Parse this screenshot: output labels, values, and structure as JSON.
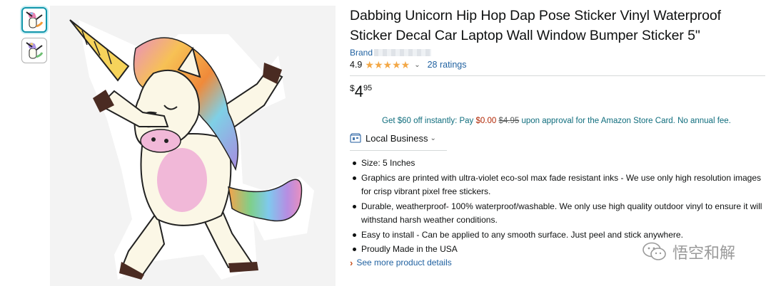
{
  "product": {
    "title": "Dabbing Unicorn Hip Hop Dap Pose Sticker Vinyl Waterproof Sticker Decal Car Laptop Wall Window Bumper Sticker 5\"",
    "brand_label": "Brand",
    "rating_value": "4.9",
    "rating_stars": 4.9,
    "ratings_count_label": "28 ratings",
    "price": {
      "symbol": "$",
      "whole": "4",
      "fraction": "95"
    },
    "promo": {
      "prefix": "Get $60 off instantly: Pay ",
      "pay_amount": "$0.00",
      "original": "$4.95",
      "suffix": " upon approval for the Amazon Store Card. No annual fee."
    },
    "business_label": "Local Business",
    "bullets": [
      "Size: 5 Inches",
      "Graphics are printed with ultra-violet eco-sol max fade resistant inks - We use only high resolution images for crisp vibrant pixel free stickers.",
      "Durable, weatherproof- 100% waterproof/washable. We only use high quality outdoor vinyl to ensure it will withstand harsh weather conditions.",
      "Easy to install - Can be applied to any smooth surface. Just peel and stick anywhere.",
      "Proudly Made in the USA"
    ],
    "see_more_label": "See more product details"
  },
  "icons": {
    "share": "share-icon",
    "star": "star-icon",
    "business": "local-business-icon",
    "wechat": "wechat-icon"
  },
  "colors": {
    "link": "#2162a1",
    "promo": "#0f6d7d",
    "star": "#f3a847",
    "price_red": "#b12704",
    "thumb_selected": "#1196ab"
  },
  "watermark": {
    "text": "悟空和解"
  }
}
